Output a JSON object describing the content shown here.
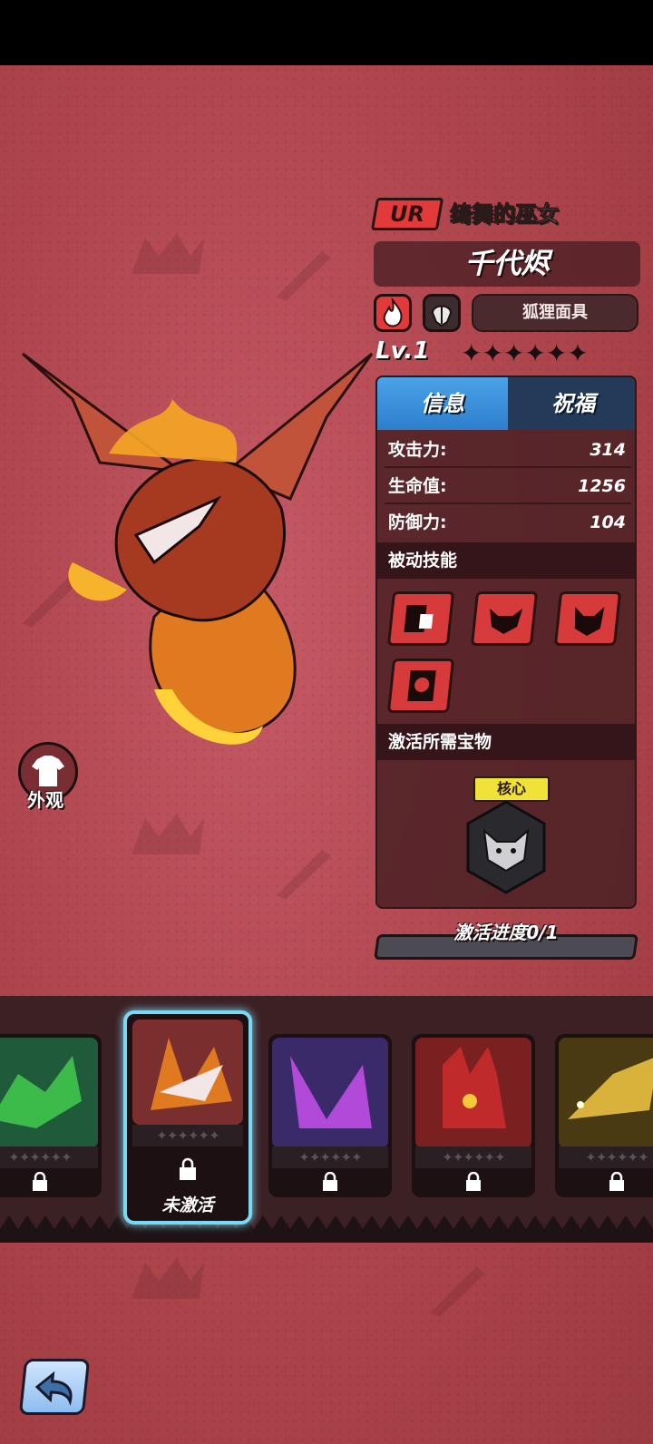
{
  "hero": {
    "rarity": "UR",
    "subtitle": "绮舞的巫女",
    "name": "千代烬",
    "tag": "狐狸面具",
    "level": "Lv.1",
    "stars": "✦✦✦✦✦✦",
    "element_icon": "fire-icon",
    "class_icon": "helmet-icon"
  },
  "tabs": {
    "info": "信息",
    "bless": "祝福"
  },
  "stats": [
    {
      "label": "攻击力:",
      "value": "314"
    },
    {
      "label": "生命值:",
      "value": "1256"
    },
    {
      "label": "防御力:",
      "value": "104"
    }
  ],
  "sections": {
    "passive": "被动技能",
    "treasure": "激活所需宝物"
  },
  "treasure": {
    "badge": "核心"
  },
  "progress": {
    "label": "激活进度0/1",
    "value": 0
  },
  "skin": {
    "label": "外观"
  },
  "cards": {
    "star_text": "✦✦✦✦✦✦",
    "selected_status": "未激活"
  },
  "colors": {
    "accent_blue": "#4ba3e8",
    "rarity_red": "#e23a3a",
    "selected_glow": "#7ad8f2"
  }
}
